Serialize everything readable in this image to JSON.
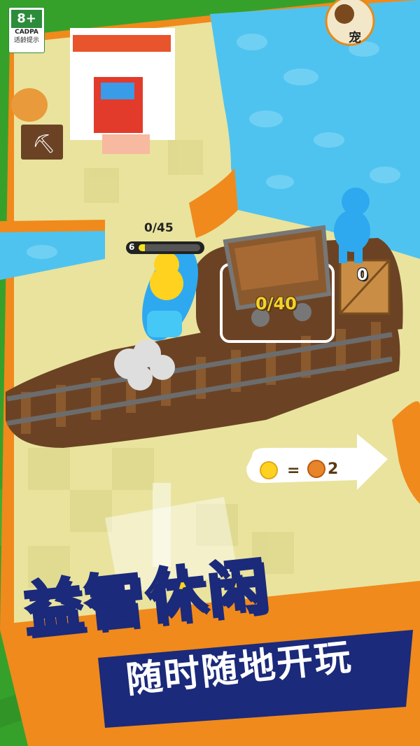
{
  "age_rating": {
    "label": "8+",
    "org": "CADPA",
    "note": "适龄提示"
  },
  "top_right_badge_text": "宠",
  "player": {
    "carry_progress": "0/45",
    "level": "6",
    "level_progress": 0.1
  },
  "cart": {
    "load": "0/40"
  },
  "crate": {
    "count": "0"
  },
  "exchange": {
    "equals": "=",
    "value": "2"
  },
  "promo": {
    "title_part1": "益智",
    "title_part2": "休闲",
    "subtitle": "随时随地开玩"
  },
  "colors": {
    "grass": "#3aa52a",
    "water": "#4fc3ef",
    "ground": "#e9e39e",
    "dirt": "#6b4324",
    "orange": "#f08a1c",
    "player_yellow": "#ffd21f",
    "npc_blue": "#2ea9f0"
  }
}
